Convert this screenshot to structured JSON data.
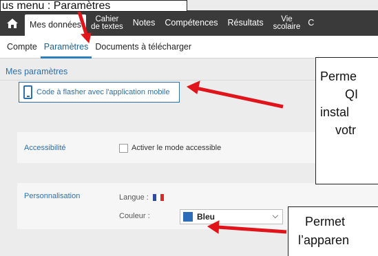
{
  "annotations": {
    "top": "us menu : Paramètres",
    "right_1": [
      "Perme",
      "QI",
      "instal",
      "votr"
    ],
    "right_2": [
      "Permet",
      "l’apparen"
    ]
  },
  "nav": {
    "items": [
      {
        "label": "Mes données"
      },
      {
        "line1": "Cahier",
        "line2": "de textes"
      },
      {
        "label": "Notes"
      },
      {
        "label": "Compétences"
      },
      {
        "label": "Résultats"
      },
      {
        "line1": "Vie",
        "line2": "scolaire"
      },
      {
        "label": "C"
      }
    ]
  },
  "subnav": {
    "items": [
      "Compte",
      "Paramètres",
      "Documents à télécharger"
    ]
  },
  "page": {
    "title": "Mes paramètres",
    "qr_button": "Code à flasher avec l'application mobile",
    "accessibility": {
      "label": "Accessibilité",
      "checkbox_label": "Activer le mode accessible"
    },
    "personalisation": {
      "label": "Personnalisation",
      "language_label": "Langue :",
      "color_label": "Couleur :",
      "color_value": "Bleu"
    }
  },
  "colors": {
    "nav_bg": "#3a3a3a",
    "accent": "#2f6fa5",
    "arrow": "#e0141a",
    "swatch": "#2e6bb8"
  }
}
